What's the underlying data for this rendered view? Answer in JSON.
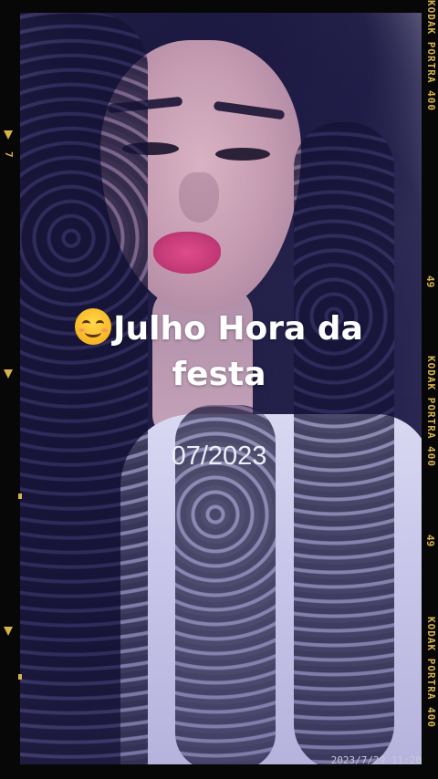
{
  "overlay": {
    "emoji": "smiling-face-emoji",
    "headline_line1": "Julho Hora da",
    "headline_line2": "festa",
    "date": "07/2023"
  },
  "timestamp": "2023/7/29 11:20",
  "film_strip": {
    "brand_top": "KODAK PORTRA 400",
    "frame_number_1": "49",
    "brand_mid": "KODAK PORTRA 400",
    "frame_number_2": "49",
    "brand_bottom": "KODAK PORTRA 400",
    "left_number": "7"
  },
  "colors": {
    "film_text": "#d7b24a",
    "overlay_text": "#ffffff"
  }
}
